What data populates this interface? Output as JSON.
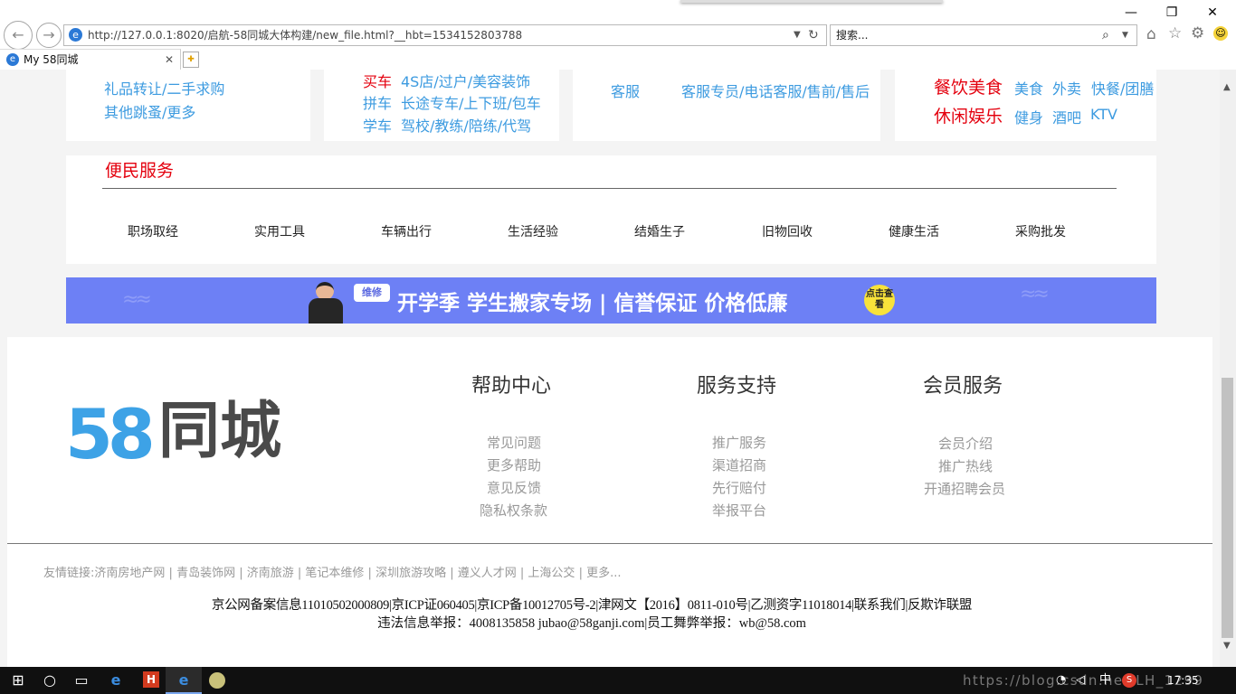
{
  "browser": {
    "url": "http://127.0.0.1:8020/启航-58同城大体构建/new_file.html?__hbt=1534152803788",
    "search_placeholder": "搜索...",
    "tab_title": "My 58同城"
  },
  "top_cards": {
    "card1": [
      "礼品转让/二手求购",
      "其他跳蚤/更多"
    ],
    "card2": [
      {
        "label": "买车",
        "links": "4S店/过户/美容装饰"
      },
      {
        "label": "拼车",
        "links": "长途专车/上下班/包车"
      },
      {
        "label": "学车",
        "links": "驾校/教练/陪练/代驾"
      }
    ],
    "card3": {
      "label": "客服",
      "links": "客服专员/电话客服/售前/售后"
    },
    "card4": [
      {
        "label": "餐饮美食",
        "links": [
          "美食",
          "外卖",
          "快餐/团膳"
        ]
      },
      {
        "label": "休闲娱乐",
        "links": [
          "健身",
          "酒吧",
          "KTV"
        ]
      }
    ]
  },
  "service": {
    "title": "便民服务",
    "items": [
      "职场取经",
      "实用工具",
      "车辆出行",
      "生活经验",
      "结婚生子",
      "旧物回收",
      "健康生活",
      "采购批发"
    ]
  },
  "banner": {
    "tag": "维修",
    "text": "开学季 学生搬家专场 | 信誉保证 价格低廉",
    "cta": "点击查看",
    "bg_color": "#6d80f5"
  },
  "footer": {
    "logo_text": "同城",
    "logo_digits": "58",
    "columns": [
      {
        "title": "帮助中心",
        "items": [
          "常见问题",
          "更多帮助",
          "意见反馈",
          "隐私权条款"
        ]
      },
      {
        "title": "服务支持",
        "items": [
          "推广服务",
          "渠道招商",
          "先行赔付",
          "举报平台"
        ]
      },
      {
        "title": "会员服务",
        "items": [
          "会员介绍",
          "推广热线",
          "开通招聘会员"
        ]
      }
    ],
    "friend_links_label": "友情链接:",
    "friend_links": [
      "济南房地产网",
      "青岛装饰网",
      "济南旅游",
      "笔记本维修",
      "深圳旅游攻略",
      "遵义人才网",
      "上海公交",
      "更多..."
    ],
    "legal_line1": "京公网备案信息11010502000809|京ICP证060405|京ICP备10012705号-2|津网文【2016】0811-010号|乙测资字11018014|联系我们|反欺诈联盟",
    "legal_line2": "违法信息举报：4008135858 jubao@58ganji.com|员工舞弊举报：wb@58.com"
  },
  "taskbar": {
    "time": "17:35",
    "ime": "中",
    "watermark": "https://blog.csdn.net/LH_1299"
  },
  "colors": {
    "link": "#3d9be0",
    "red": "#e4000e",
    "banner": "#6d80f5"
  }
}
